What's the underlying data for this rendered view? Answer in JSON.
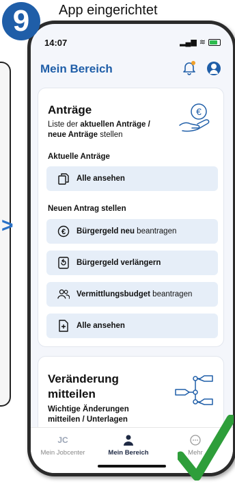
{
  "step": {
    "number": "9",
    "title": "App eingerichtet"
  },
  "status": {
    "time": "14:07"
  },
  "header": {
    "title": "Mein Bereich"
  },
  "card1": {
    "title": "Anträge",
    "desc_prefix": "Liste der ",
    "desc_bold1": "aktuellen Anträge /",
    "desc_bold2": "neue Anträge",
    "desc_suffix": " stellen",
    "section_current": "Aktuelle Anträge",
    "current_all": "Alle ansehen",
    "section_new": "Neuen Antrag stellen",
    "buergergeld_new_bold": "Bürgergeld neu",
    "buergergeld_new_rest": " beantragen",
    "buergergeld_extend": "Bürgergeld verlängern",
    "vermittlung_bold": "Vermittlungsbudget",
    "vermittlung_rest": " beantragen",
    "new_all": "Alle ansehen"
  },
  "card2": {
    "title": "Veränderung mitteilen",
    "desc": "Wichtige Änderungen mitteilen / Unterlagen"
  },
  "tabs": [
    {
      "label": "Mein Jobcenter",
      "icon": "jc-logo-icon"
    },
    {
      "label": "Mein Bereich",
      "icon": "person-icon"
    },
    {
      "label": "Mehr",
      "icon": "more-icon"
    }
  ],
  "colors": {
    "brand": "#1f5ea8",
    "action_bg": "#e6eef8",
    "check": "#2e9e3a"
  }
}
